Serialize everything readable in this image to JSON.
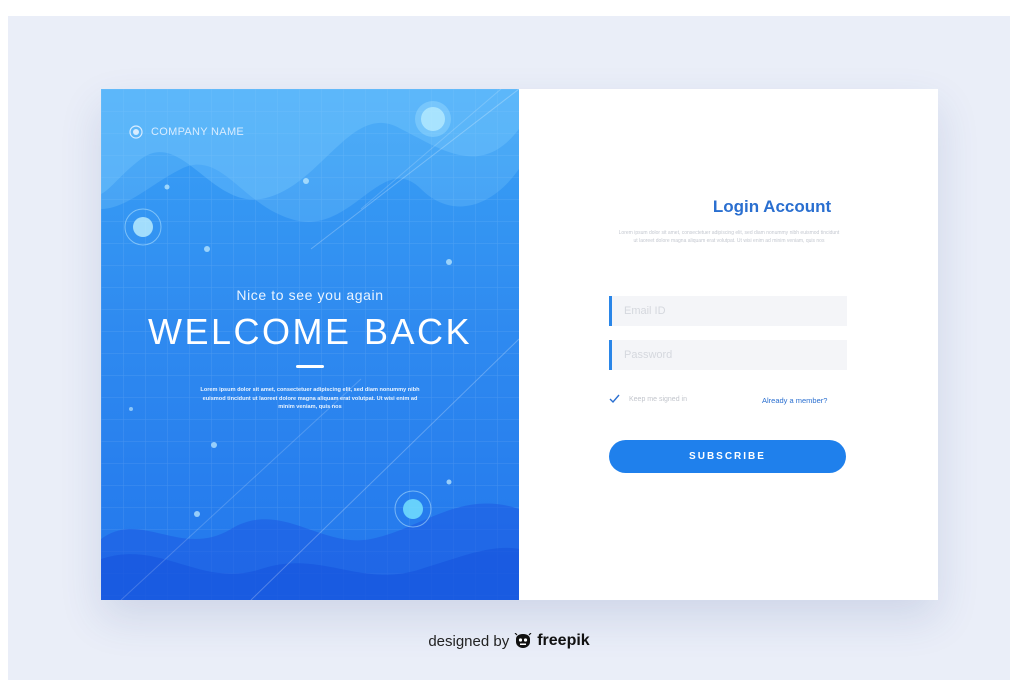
{
  "brand": {
    "company_name": "COMPANY NAME",
    "logo_icon": "circle-target-icon"
  },
  "hero": {
    "greeting": "Nice to see you again",
    "headline": "WELCOME BACK",
    "description": "Lorem ipsum dolor sit amet, consectetuer adipiscing elit, sed diam nonummy nibh euismod tincidunt ut laoreet dolore magna aliquam erat volutpat. Ut wisi enim ad minim veniam, quis nos"
  },
  "login": {
    "title": "Login Account",
    "description": "Lorem ipsum dolor sit amet, consectetuer adipiscing elit, sed diam nonummy nibh euismod tincidunt ut laoreet dolore magna aliquam erat volutpat. Ut wisi enim ad minim veniam, quis nos",
    "email_placeholder": "Email ID",
    "email_value": "",
    "password_placeholder": "Password",
    "password_value": "",
    "remember_label": "Keep me signed in",
    "remember_checked": true,
    "member_link": "Already a member?",
    "submit_label": "SUBSCRIBE"
  },
  "footer": {
    "prefix": "designed by",
    "brand": "freepik",
    "brand_icon": "freepik-logo-icon"
  },
  "colors": {
    "accent": "#1f80ec",
    "title_blue": "#2a6fd0",
    "page_background": "#eaeef8"
  }
}
